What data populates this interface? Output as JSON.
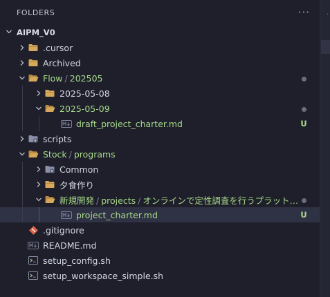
{
  "explorer": {
    "title": "FOLDERS",
    "more_label": "···",
    "root": {
      "label": "AIPM_V0"
    }
  },
  "tree": [
    {
      "label": ".cursor",
      "type": "folder",
      "depth": 1,
      "open": false,
      "name": "folder-cursor"
    },
    {
      "label": "Archived",
      "type": "folder",
      "depth": 1,
      "open": false,
      "name": "folder-archived"
    },
    {
      "label": "Flow",
      "extra": "202505",
      "type": "folder",
      "depth": 1,
      "open": true,
      "modified": true,
      "badge": "dot",
      "name": "folder-flow"
    },
    {
      "label": "2025-05-08",
      "type": "folder",
      "depth": 2,
      "open": false,
      "name": "folder-2025-05-08"
    },
    {
      "label": "2025-05-09",
      "type": "folder",
      "depth": 2,
      "open": true,
      "modified": true,
      "badge": "dot",
      "name": "folder-2025-05-09"
    },
    {
      "label": "draft_project_charter.md",
      "type": "md",
      "depth": 3,
      "modified": true,
      "badge": "U",
      "name": "file-draft-project-charter"
    },
    {
      "label": "scripts",
      "type": "gear-folder",
      "depth": 1,
      "open": false,
      "name": "folder-scripts"
    },
    {
      "label": "Stock",
      "extra": "programs",
      "type": "folder",
      "depth": 1,
      "open": true,
      "modified": true,
      "name": "folder-stock"
    },
    {
      "label": "Common",
      "type": "gear-folder",
      "depth": 2,
      "open": false,
      "name": "folder-common"
    },
    {
      "label": "夕食作り",
      "type": "folder",
      "depth": 2,
      "open": false,
      "name": "folder-dinner"
    },
    {
      "label": "新規開発",
      "extra": "projects",
      "extra2": "オンラインで定性調査を行うプラットフ...",
      "type": "folder",
      "depth": 2,
      "open": true,
      "modified": true,
      "badge": "dot",
      "name": "folder-new-development"
    },
    {
      "label": "project_charter.md",
      "type": "md",
      "depth": 3,
      "modified": true,
      "badge": "U",
      "selected": true,
      "name": "file-project-charter"
    },
    {
      "label": ".gitignore",
      "type": "git",
      "depth": 1,
      "name": "file-gitignore"
    },
    {
      "label": "README.md",
      "type": "md",
      "depth": 1,
      "name": "file-readme"
    },
    {
      "label": "setup_config.sh",
      "type": "sh",
      "depth": 1,
      "name": "file-setup-config"
    },
    {
      "label": "setup_workspace_simple.sh",
      "type": "sh",
      "depth": 1,
      "name": "file-setup-workspace-simple"
    }
  ],
  "colors": {
    "background": "#1e1f2b",
    "folder": "#d6a95a",
    "modified": "#a9d98a",
    "git": "#e0664f",
    "badge_dot": "#6b6e7d",
    "selection": "#2f3144"
  }
}
